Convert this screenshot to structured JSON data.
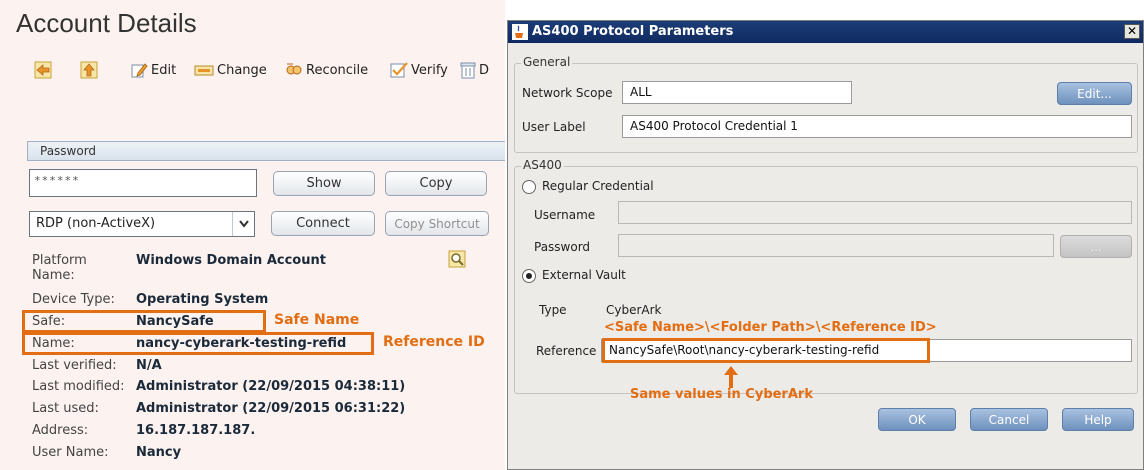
{
  "account": {
    "title": "Account Details",
    "toolbar": {
      "edit": "Edit",
      "change": "Change",
      "reconcile": "Reconcile",
      "verify": "Verify",
      "cut": "D"
    },
    "password_section": {
      "header": "Password",
      "value": "******",
      "show": "Show",
      "copy": "Copy",
      "connect_option": "RDP (non-ActiveX)",
      "connect": "Connect",
      "copy_shortcut": "Copy Shortcut"
    },
    "properties": [
      {
        "label": "Platform Name:",
        "value": "Windows Domain Account"
      },
      {
        "label": "Device Type:",
        "value": "Operating System"
      },
      {
        "label": "Safe:",
        "value": "NancySafe"
      },
      {
        "label": "Name:",
        "value": "nancy-cyberark-testing-refid"
      },
      {
        "label": "Last verified:",
        "value": "N/A"
      },
      {
        "label": "Last modified:",
        "value": "Administrator (22/09/2015 04:38:11)"
      },
      {
        "label": "Last used:",
        "value": "Administrator (22/09/2015 06:31:22)"
      },
      {
        "label": "Address:",
        "value": "16.187.187.187."
      },
      {
        "label": "User Name:",
        "value": "Nancy"
      }
    ],
    "platform_label_line1": "Platform",
    "platform_label_line2": "Name:",
    "annotations": {
      "safe_name": "Safe Name",
      "reference_id": "Reference ID"
    }
  },
  "dialog": {
    "title": "AS400 Protocol Parameters",
    "general_legend": "General",
    "network_scope_label": "Network Scope",
    "network_scope_value": "ALL",
    "edit_button": "Edit...",
    "user_label_label": "User Label",
    "user_label_value": "AS400 Protocol Credential 1",
    "as400_legend": "AS400",
    "regular_credential": "Regular Credential",
    "regular_selected": false,
    "username_label": "Username",
    "username_value": "",
    "password_label": "Password",
    "password_value": "",
    "browse_button": "...",
    "external_vault": "External Vault",
    "external_selected": true,
    "type_label": "Type",
    "type_value": "CyberArk",
    "path_hint": "<Safe Name>\\<Folder Path>\\<Reference ID>",
    "reference_label": "Reference",
    "reference_value": "NancySafe\\Root\\nancy-cyberark-testing-refid",
    "same_values_note": "Same values in CyberArk",
    "ok": "OK",
    "cancel": "Cancel",
    "help": "Help"
  },
  "colors": {
    "annotation": "#e26d12",
    "dialog_title_bg": "#0f2a60",
    "left_panel_bg": "#fcf2ef",
    "dialog_bg": "#ecebe8"
  }
}
